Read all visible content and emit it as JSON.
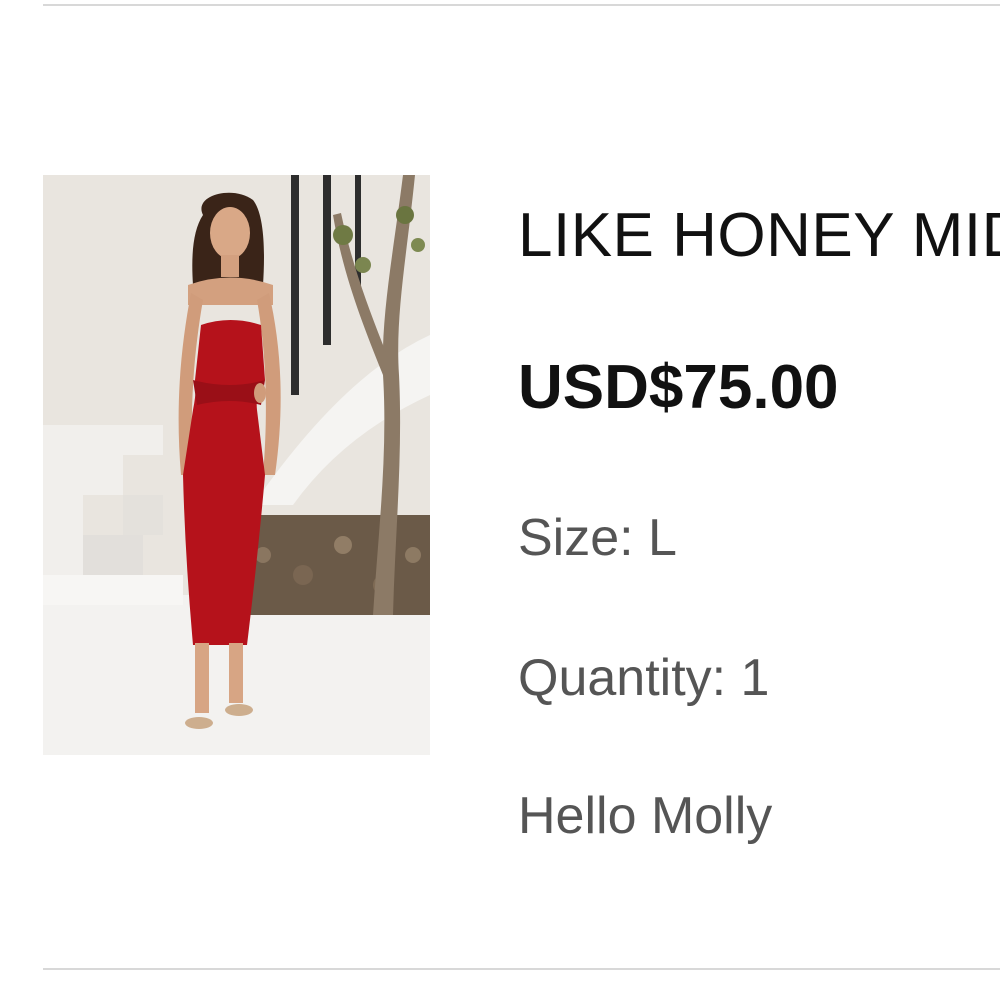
{
  "product": {
    "name": "LIKE HONEY MIDI DRESS RED",
    "price": "USD$75.00",
    "size_text": "Size: L",
    "quantity_text": "Quantity: 1",
    "brand": "Hello Molly",
    "image_subject": "model-in-red-midi-dress"
  },
  "colors": {
    "dress": "#b5121b",
    "text_primary": "#111111",
    "text_secondary": "#555555",
    "divider": "#d8d8d8"
  }
}
